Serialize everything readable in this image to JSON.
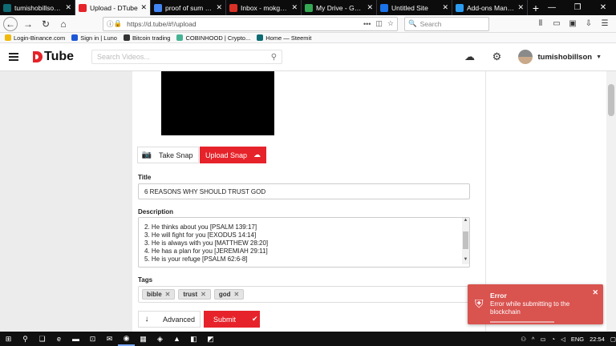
{
  "browser": {
    "tabs": [
      {
        "label": "tumishobillson (@tumis",
        "favicon_color": "#0e6b74",
        "favicon_icon": "steemit-icon",
        "active": false
      },
      {
        "label": "Upload - DTube",
        "favicon_color": "#e6232a",
        "favicon_icon": "dtube-icon",
        "active": true
      },
      {
        "label": "proof of sum of y eq",
        "favicon_color": "#4285f4",
        "favicon_icon": "google-icon",
        "active": false
      },
      {
        "label": "Inbox - mokgonyana",
        "favicon_color": "#d93025",
        "favicon_icon": "gmail-icon",
        "active": false
      },
      {
        "label": "My Drive - Google D",
        "favicon_color": "#34a853",
        "favicon_icon": "drive-icon",
        "active": false
      },
      {
        "label": "Untitled Site",
        "favicon_color": "#1a73e8",
        "favicon_icon": "sites-icon",
        "active": false
      },
      {
        "label": "Add-ons Manager",
        "favicon_color": "#2b9cf2",
        "favicon_icon": "puzzle-icon",
        "active": false
      }
    ],
    "url": "https://d.tube/#!/upload",
    "search_placeholder": "Search",
    "bookmarks": [
      {
        "label": "Login-Binance.com",
        "color": "#f0b90b"
      },
      {
        "label": "Sign in | Luno",
        "color": "#1d57d6"
      },
      {
        "label": "Bitcoin trading",
        "color": "#333333"
      },
      {
        "label": "COBINHOOD | Crypto...",
        "color": "#47b394"
      },
      {
        "label": "Home — Steemit",
        "color": "#0e6b74"
      }
    ]
  },
  "app": {
    "logo": "Tube",
    "search_placeholder": "Search Videos...",
    "username": "tumishobillson",
    "take_snap": "Take Snap",
    "upload_snap": "Upload Snap",
    "title_label": "Title",
    "title_value": "6 REASONS WHY SHOULD TRUST GOD",
    "description_label": "Description",
    "description_lines": [
      "2. He thinks about you [PSALM 139:17]",
      "3. He will fight for you [EXODUS 14:14]",
      "3. He is always with you [MATTHEW 28:20]",
      "4. He has a plan for you [JEREMIAH 29:11]",
      "5. He is your refuge [PSALM 62:6-8]"
    ],
    "tags_label": "Tags",
    "tags": [
      "bible",
      "trust",
      "god"
    ],
    "advanced": "Advanced",
    "submit": "Submit",
    "accent": "#e6232a"
  },
  "toast": {
    "title": "Error",
    "message": "Error while submitting to the blockchain",
    "color": "#d9534f"
  },
  "taskbar": {
    "lang": "ENG",
    "time": "22:54"
  }
}
